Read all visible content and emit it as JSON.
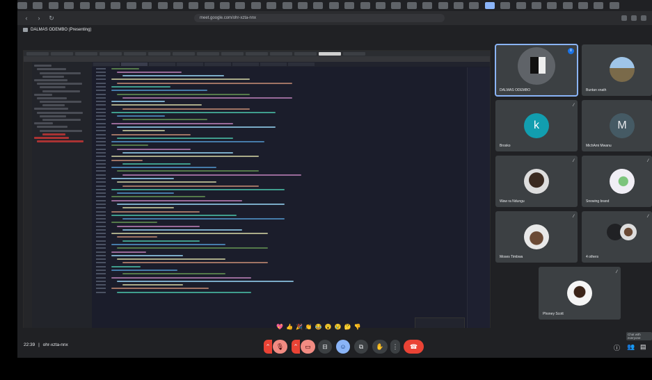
{
  "presenter": {
    "label": "DALMAS ODEMBO (Presenting)"
  },
  "browser": {
    "address": "meet.google.com/ohr-xzta-nnx"
  },
  "meeting": {
    "time": "22:39",
    "separator": "|",
    "code": "ohr-xzta-nnx"
  },
  "participants": [
    {
      "name": "DALMAS ODEMBO",
      "kind": "screen",
      "mic": "speaking"
    },
    {
      "name": "Buntan xnath",
      "kind": "photo",
      "mic": ""
    },
    {
      "name": "Brosko",
      "kind": "letter",
      "letter": "k",
      "color": "#129eaf",
      "mic": "muted"
    },
    {
      "name": "MichAmi Mwanu",
      "kind": "letter",
      "letter": "M",
      "color": "#455a64",
      "mic": ""
    },
    {
      "name": "Waw ra Ndungu",
      "kind": "photo",
      "mic": "muted"
    },
    {
      "name": "Snowing brand",
      "kind": "photo",
      "mic": "muted"
    },
    {
      "name": "Moses Timbwa",
      "kind": "photo",
      "mic": "muted"
    },
    {
      "name": "4 others",
      "kind": "group",
      "mic": ""
    },
    {
      "name": "Phoney Scott",
      "kind": "photo",
      "mic": "muted"
    }
  ],
  "reactions": [
    "💖",
    "👍",
    "🎉",
    "👏",
    "😂",
    "😮",
    "😢",
    "🤔",
    "👎"
  ],
  "tooltip": "Chat with everyone"
}
